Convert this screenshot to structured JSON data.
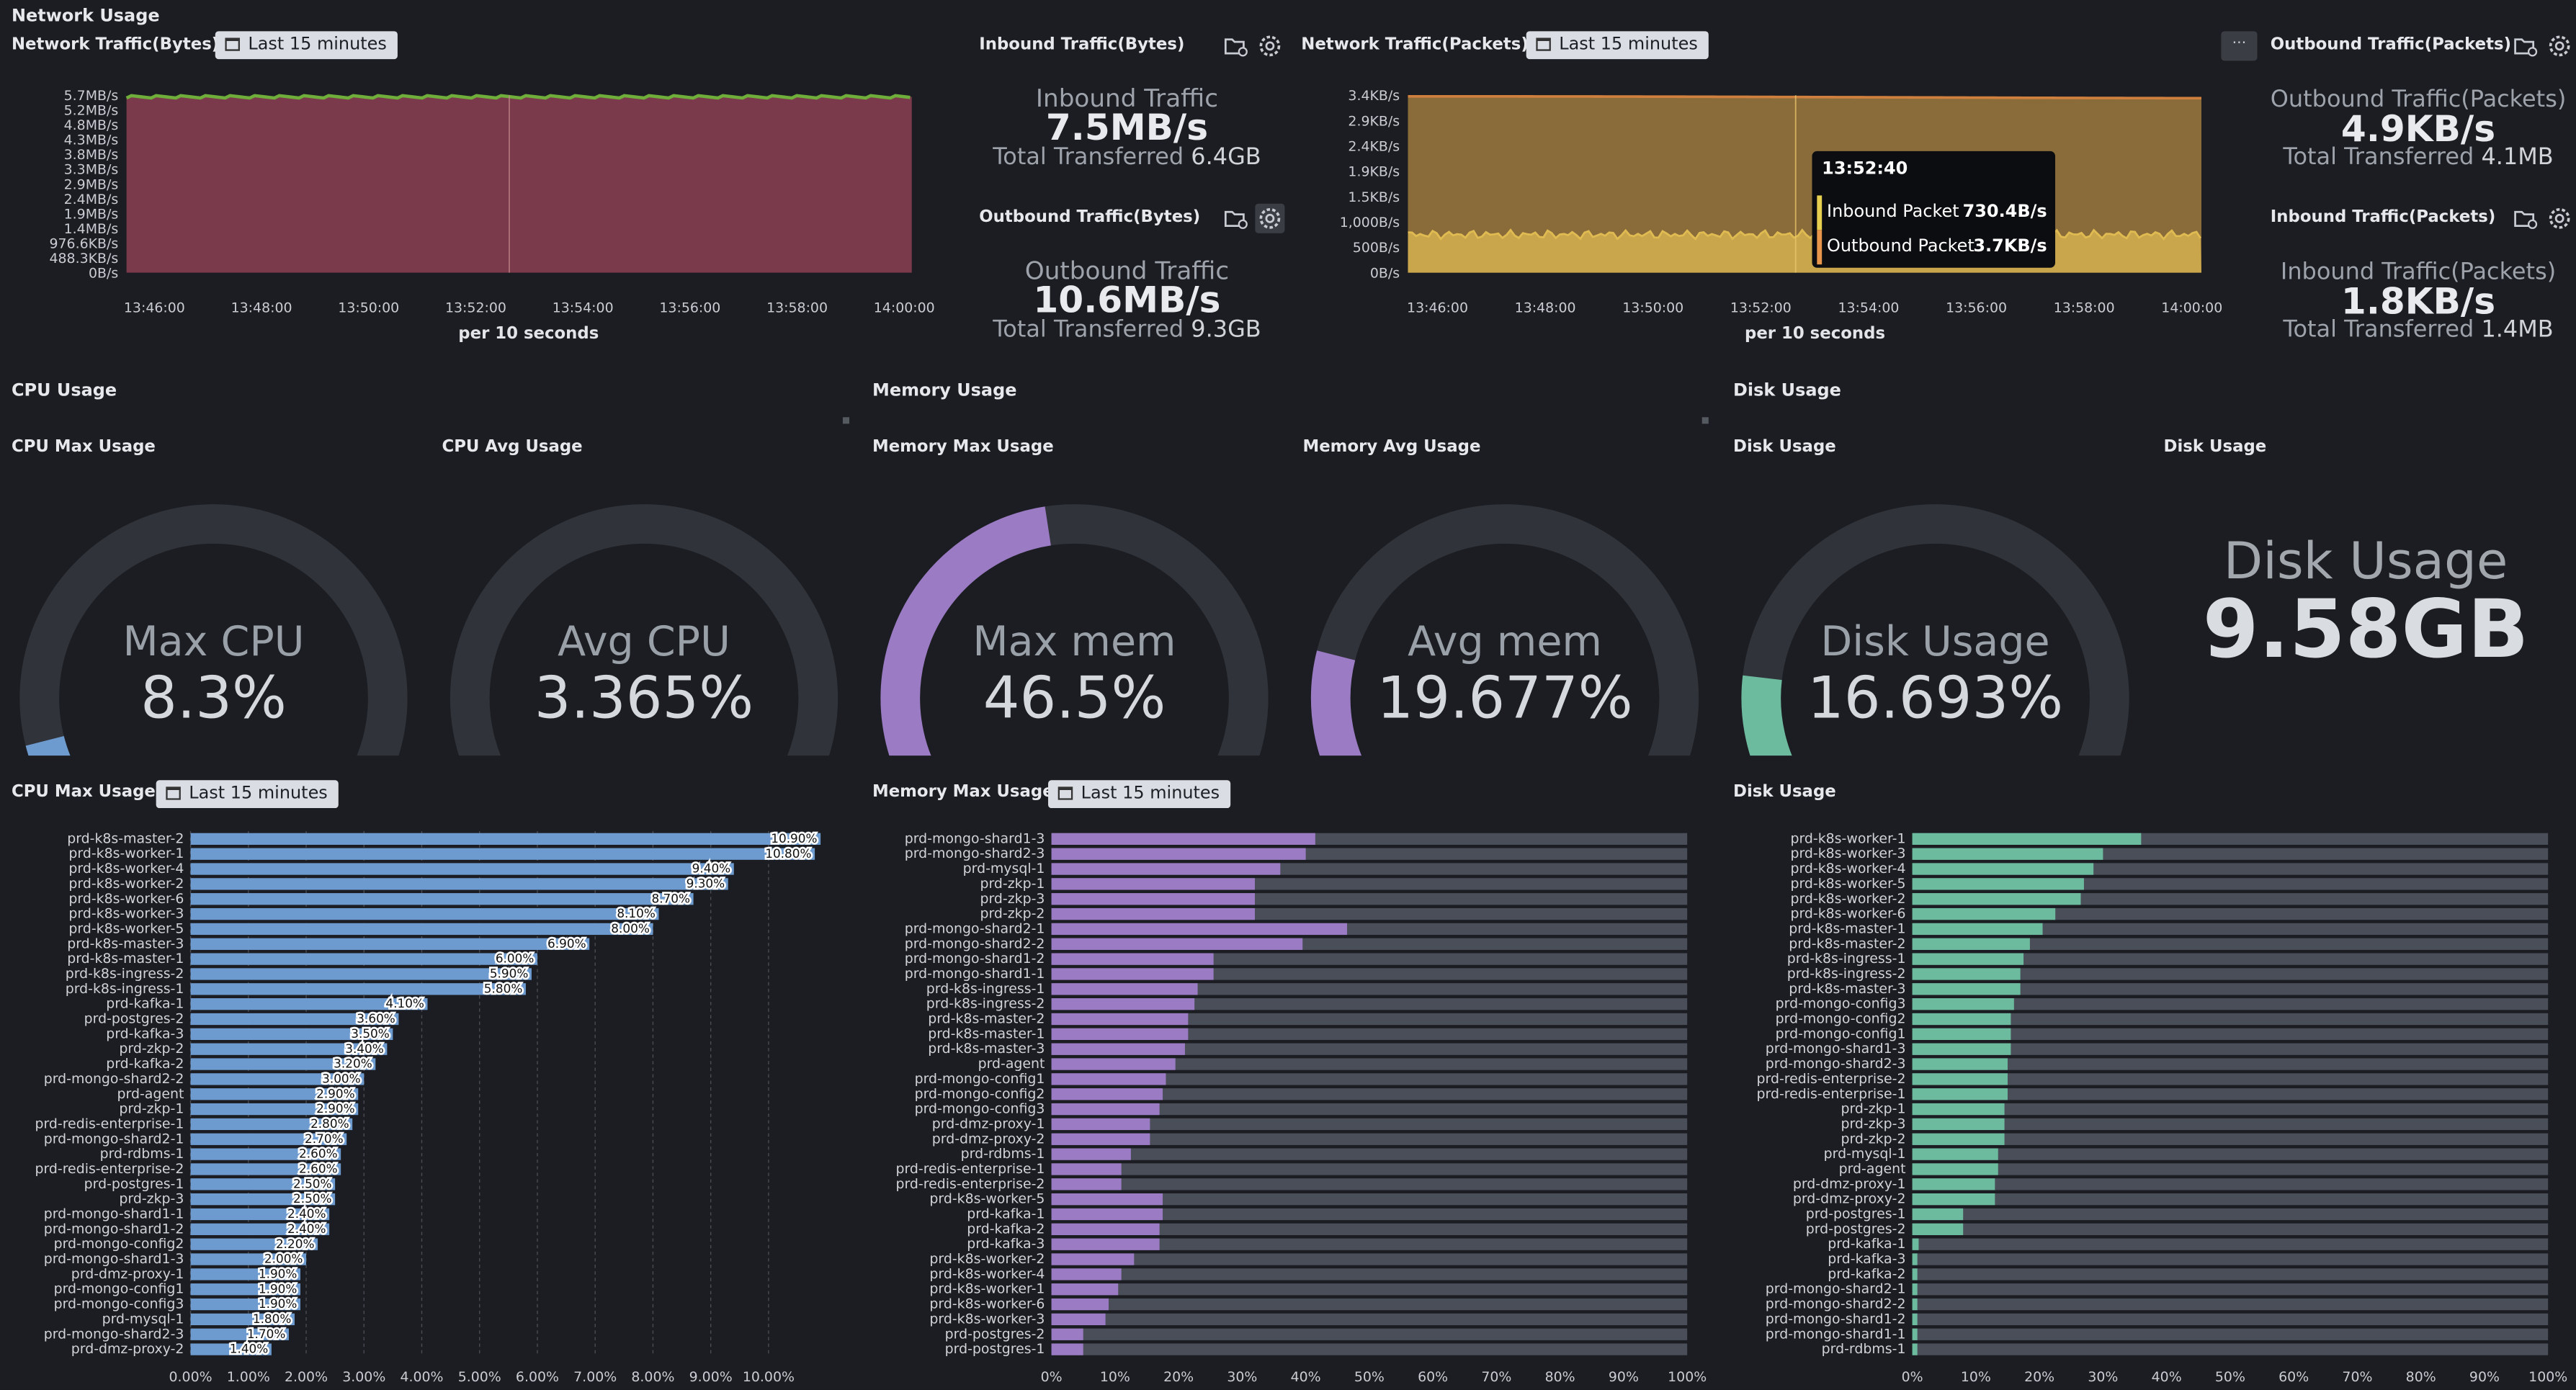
{
  "header": {
    "title": "Network Usage"
  },
  "network": {
    "bytes_chart": {
      "title": "Network Traffic(Bytes)",
      "time_range": "Last 15 minutes",
      "footer": "per 10 seconds"
    },
    "inbound_bytes": {
      "title": "Inbound Traffic(Bytes)",
      "label": "Inbound Traffic",
      "value": "7.5MB/s",
      "total_label": "Total Transferred",
      "total_value": "6.4GB"
    },
    "outbound_bytes": {
      "title": "Outbound Traffic(Bytes)",
      "label": "Outbound Traffic",
      "value": "10.6MB/s",
      "total_label": "Total Transferred",
      "total_value": "9.3GB"
    },
    "packets_chart": {
      "title": "Network Traffic(Packets)",
      "time_range": "Last 15 minutes",
      "footer": "per 10 seconds",
      "tooltip": {
        "time": "13:52:40",
        "rows": [
          {
            "name": "Inbound Packet",
            "value": "730.4B/s",
            "color": "#e7cf4f"
          },
          {
            "name": "Outbound Packet",
            "value": "3.7KB/s",
            "color": "#e8964b"
          }
        ]
      }
    },
    "outbound_packets": {
      "title": "Outbound Traffic(Packets)",
      "label": "Outbound Traffic(Packets)",
      "value": "4.9KB/s",
      "total_label": "Total Transferred",
      "total_value": "4.1MB"
    },
    "inbound_packets": {
      "title": "Inbound Traffic(Packets)",
      "label": "Inbound Traffic(Packets)",
      "value": "1.8KB/s",
      "total_label": "Total Transferred",
      "total_value": "1.4MB"
    }
  },
  "sections": {
    "cpu": "CPU Usage",
    "memory": "Memory Usage",
    "disk": "Disk Usage"
  },
  "gauges": {
    "cpu_max": {
      "title": "CPU Max Usage",
      "label": "Max CPU",
      "value": "8.3%",
      "fraction": 0.083,
      "color": "#6d9bd0"
    },
    "cpu_avg": {
      "title": "CPU Avg Usage",
      "label": "Avg CPU",
      "value": "3.365%",
      "fraction": 0.03365,
      "color": "#6d9bd0"
    },
    "mem_max": {
      "title": "Memory Max Usage",
      "label": "Max mem",
      "value": "46.5%",
      "fraction": 0.465,
      "color": "#9a7bc4"
    },
    "mem_avg": {
      "title": "Memory Avg Usage",
      "label": "Avg mem",
      "value": "19.677%",
      "fraction": 0.19677,
      "color": "#9a7bc4"
    },
    "disk": {
      "title": "Disk Usage",
      "label": "Disk Usage",
      "value": "16.693%",
      "fraction": 0.16693,
      "color": "#6dbb9e"
    }
  },
  "disk_stat": {
    "title": "Disk Usage",
    "label": "Disk Usage",
    "value": "9.58GB"
  },
  "bar_panels": {
    "cpu": {
      "title": "CPU Max Usage",
      "time_range": "Last 15 minutes"
    },
    "memory": {
      "title": "Memory Max Usage",
      "time_range": "Last 15 minutes"
    },
    "disk": {
      "title": "Disk Usage"
    }
  },
  "chart_data": [
    {
      "type": "area",
      "name": "network-bytes",
      "x": [
        "13:46:00",
        "13:48:00",
        "13:50:00",
        "13:52:00",
        "13:54:00",
        "13:56:00",
        "13:58:00",
        "14:00:00"
      ],
      "y_ticks": [
        "0B/s",
        "488.3KB/s",
        "976.6KB/s",
        "1.4MB/s",
        "1.9MB/s",
        "2.4MB/s",
        "2.9MB/s",
        "3.3MB/s",
        "3.8MB/s",
        "4.3MB/s",
        "4.8MB/s",
        "5.2MB/s",
        "5.7MB/s"
      ],
      "ylim": [
        0,
        5.7
      ],
      "colors": {
        "fill": "#7a3a4c",
        "top": "#6fae3a"
      },
      "level": 5.65
    },
    {
      "type": "area",
      "name": "network-packets",
      "x": [
        "13:46:00",
        "13:48:00",
        "13:50:00",
        "13:52:00",
        "13:54:00",
        "13:56:00",
        "13:58:00",
        "14:00:00"
      ],
      "y_ticks": [
        "0B/s",
        "500B/s",
        "1,000B/s",
        "1.5KB/s",
        "1.9KB/s",
        "2.4KB/s",
        "2.9KB/s",
        "3.4KB/s"
      ],
      "ylim": [
        0,
        3.4
      ],
      "series": [
        {
          "name": "Inbound Packet",
          "level": 0.73,
          "color": "#c9a64c"
        },
        {
          "name": "Outbound Packet",
          "level": 3.36,
          "color": "#8a6c3a"
        }
      ]
    },
    {
      "type": "bar",
      "name": "cpu-max-usage",
      "orientation": "horizontal",
      "xlim": [
        0,
        11
      ],
      "x_ticks": [
        "0.00%",
        "1.00%",
        "2.00%",
        "3.00%",
        "4.00%",
        "5.00%",
        "6.00%",
        "7.00%",
        "8.00%",
        "9.00%",
        "10.00%"
      ],
      "color": "#6d9bd0",
      "categories": [
        "prd-k8s-master-2",
        "prd-k8s-worker-1",
        "prd-k8s-worker-4",
        "prd-k8s-worker-2",
        "prd-k8s-worker-6",
        "prd-k8s-worker-3",
        "prd-k8s-worker-5",
        "prd-k8s-master-3",
        "prd-k8s-master-1",
        "prd-k8s-ingress-2",
        "prd-k8s-ingress-1",
        "prd-kafka-1",
        "prd-postgres-2",
        "prd-kafka-3",
        "prd-zkp-2",
        "prd-kafka-2",
        "prd-mongo-shard2-2",
        "prd-agent",
        "prd-zkp-1",
        "prd-redis-enterprise-1",
        "prd-mongo-shard2-1",
        "prd-rdbms-1",
        "prd-redis-enterprise-2",
        "prd-postgres-1",
        "prd-zkp-3",
        "prd-mongo-shard1-1",
        "prd-mongo-shard1-2",
        "prd-mongo-config2",
        "prd-mongo-shard1-3",
        "prd-dmz-proxy-1",
        "prd-mongo-config1",
        "prd-mongo-config3",
        "prd-mysql-1",
        "prd-mongo-shard2-3",
        "prd-dmz-proxy-2"
      ],
      "values": [
        10.9,
        10.8,
        9.4,
        9.3,
        8.7,
        8.1,
        8.0,
        6.9,
        6.0,
        5.9,
        5.8,
        4.1,
        3.6,
        3.5,
        3.4,
        3.2,
        3.0,
        2.9,
        2.9,
        2.8,
        2.7,
        2.6,
        2.6,
        2.5,
        2.5,
        2.4,
        2.4,
        2.2,
        2.0,
        1.9,
        1.9,
        1.9,
        1.8,
        1.7,
        1.4
      ],
      "labels": [
        "10.90%",
        "10.80%",
        "9.40%",
        "9.30%",
        "8.70%",
        "8.10%",
        "8.00%",
        "6.90%",
        "6.00%",
        "5.90%",
        "5.80%",
        "4.10%",
        "3.60%",
        "3.50%",
        "3.40%",
        "3.20%",
        "3.00%",
        "2.90%",
        "2.90%",
        "2.80%",
        "2.70%",
        "2.60%",
        "2.60%",
        "2.50%",
        "2.50%",
        "2.40%",
        "2.40%",
        "2.20%",
        "2.00%",
        "1.90%",
        "1.90%",
        "1.90%",
        "1.80%",
        "1.70%",
        "1.40%"
      ]
    },
    {
      "type": "bar",
      "name": "memory-max-usage",
      "orientation": "horizontal",
      "xlim": [
        0,
        100
      ],
      "x_ticks": [
        "0%",
        "10%",
        "20%",
        "30%",
        "40%",
        "50%",
        "60%",
        "70%",
        "80%",
        "90%",
        "100%"
      ],
      "color": "#9a7bc4",
      "track_color": "#4a4e59",
      "categories": [
        "prd-mongo-shard1-3",
        "prd-mongo-shard2-3",
        "prd-mysql-1",
        "prd-zkp-1",
        "prd-zkp-3",
        "prd-zkp-2",
        "prd-mongo-shard2-1",
        "prd-mongo-shard2-2",
        "prd-mongo-shard1-2",
        "prd-mongo-shard1-1",
        "prd-k8s-ingress-1",
        "prd-k8s-ingress-2",
        "prd-k8s-master-2",
        "prd-k8s-master-1",
        "prd-k8s-master-3",
        "prd-agent",
        "prd-mongo-config1",
        "prd-mongo-config2",
        "prd-mongo-config3",
        "prd-dmz-proxy-1",
        "prd-dmz-proxy-2",
        "prd-rdbms-1",
        "prd-redis-enterprise-1",
        "prd-redis-enterprise-2",
        "prd-k8s-worker-5",
        "prd-kafka-1",
        "prd-kafka-2",
        "prd-kafka-3",
        "prd-k8s-worker-2",
        "prd-k8s-worker-4",
        "prd-k8s-worker-1",
        "prd-k8s-worker-6",
        "prd-k8s-worker-3",
        "prd-postgres-2",
        "prd-postgres-1"
      ],
      "values": [
        41.5,
        40.0,
        36.0,
        32.0,
        32.0,
        32.0,
        46.5,
        39.5,
        25.5,
        25.5,
        23.0,
        22.5,
        21.5,
        21.5,
        21.0,
        19.5,
        18.0,
        17.5,
        17.0,
        15.5,
        15.5,
        12.5,
        11.0,
        11.0,
        17.5,
        17.5,
        17.0,
        17.0,
        13.0,
        11.0,
        10.5,
        9.0,
        8.5,
        5.0,
        5.0
      ]
    },
    {
      "type": "bar",
      "name": "disk-usage",
      "orientation": "horizontal",
      "xlim": [
        0,
        100
      ],
      "x_ticks": [
        "0%",
        "10%",
        "20%",
        "30%",
        "40%",
        "50%",
        "60%",
        "70%",
        "80%",
        "90%",
        "100%"
      ],
      "color": "#6dbb9e",
      "track_color": "#4a4e59",
      "categories": [
        "prd-k8s-worker-1",
        "prd-k8s-worker-3",
        "prd-k8s-worker-4",
        "prd-k8s-worker-5",
        "prd-k8s-worker-2",
        "prd-k8s-worker-6",
        "prd-k8s-master-1",
        "prd-k8s-master-2",
        "prd-k8s-ingress-1",
        "prd-k8s-ingress-2",
        "prd-k8s-master-3",
        "prd-mongo-config3",
        "prd-mongo-config2",
        "prd-mongo-config1",
        "prd-mongo-shard1-3",
        "prd-mongo-shard2-3",
        "prd-redis-enterprise-2",
        "prd-redis-enterprise-1",
        "prd-zkp-1",
        "prd-zkp-3",
        "prd-zkp-2",
        "prd-mysql-1",
        "prd-agent",
        "prd-dmz-proxy-1",
        "prd-dmz-proxy-2",
        "prd-postgres-1",
        "prd-postgres-2",
        "prd-kafka-1",
        "prd-kafka-3",
        "prd-kafka-2",
        "prd-mongo-shard2-1",
        "prd-mongo-shard2-2",
        "prd-mongo-shard1-2",
        "prd-mongo-shard1-1",
        "prd-rdbms-1"
      ],
      "values": [
        36.0,
        30.0,
        28.5,
        27.0,
        26.5,
        22.5,
        20.5,
        18.5,
        17.5,
        17.0,
        17.0,
        16.0,
        15.5,
        15.5,
        15.5,
        15.0,
        15.0,
        15.0,
        14.5,
        14.5,
        14.5,
        13.5,
        13.5,
        13.0,
        13.0,
        8.0,
        8.0,
        1.0,
        0.8,
        0.8,
        0.8,
        0.8,
        0.8,
        0.8,
        0.8
      ]
    }
  ]
}
